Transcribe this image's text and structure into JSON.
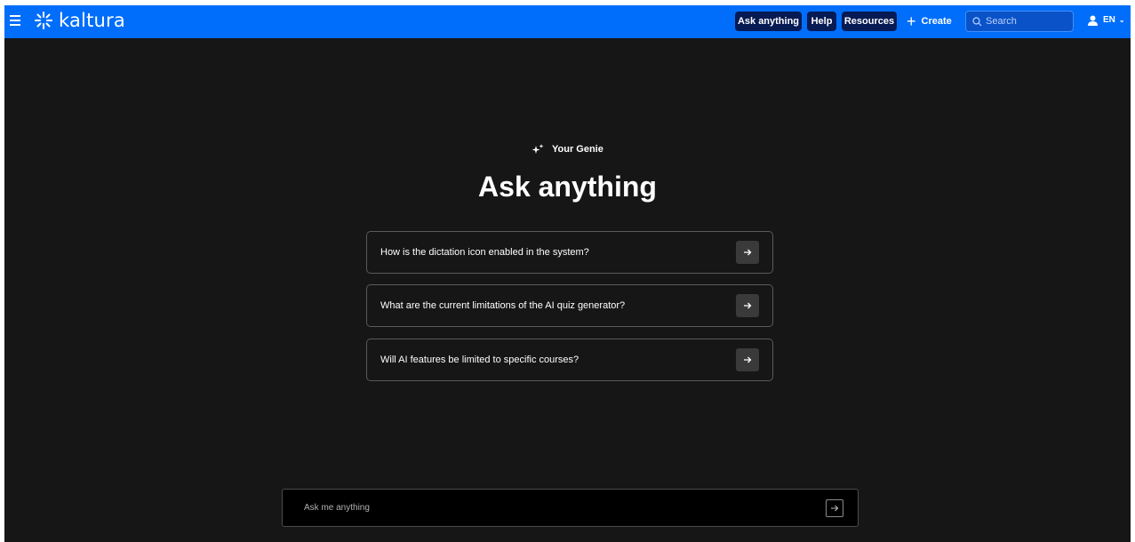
{
  "brand": {
    "name": "kaltura"
  },
  "header": {
    "nav": [
      {
        "label": "Ask anything"
      },
      {
        "label": "Help"
      },
      {
        "label": "Resources"
      }
    ],
    "create_label": "Create",
    "search": {
      "placeholder": "Search"
    },
    "language": "EN"
  },
  "main": {
    "genie_label": "Your Genie",
    "title": "Ask anything",
    "suggestions": [
      {
        "text": "How is the dictation icon enabled in the system?"
      },
      {
        "text": "What are the current limitations of the AI quiz generator?"
      },
      {
        "text": "Will AI features be limited to specific courses?"
      }
    ]
  },
  "ask_input": {
    "placeholder": "Ask me anything"
  },
  "colors": {
    "topbar": "#006efa",
    "nav_button": "#061a54",
    "background": "#161616",
    "text": "#ffffff"
  }
}
